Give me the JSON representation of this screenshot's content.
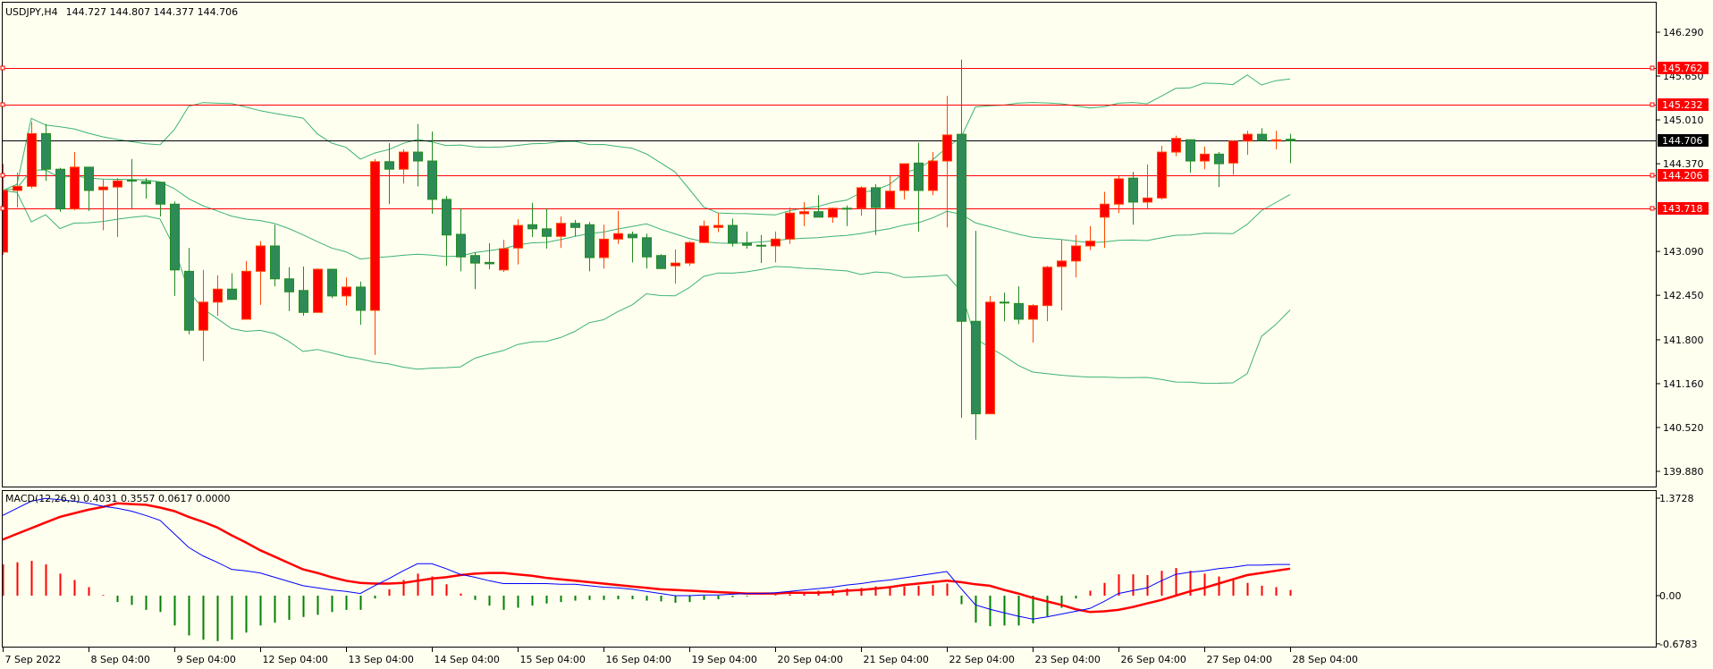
{
  "header": {
    "symbol_timeframe": "USDJPY,H4",
    "ohlc": "144.727 144.807 144.377 144.706"
  },
  "macd_header": "MACD(12,26,9) 0.4031 0.3557 0.0617 0.0000",
  "colors": {
    "background": "#fffff0",
    "bull_fill": "#ff0000",
    "bull_border": "#ff4500",
    "bear_fill": "#2e8b57",
    "bear_border": "#228b22",
    "bands": "#3cb371",
    "level_line": "#ff0000",
    "bid_line": "#000000",
    "macd_line": "#0000ff",
    "signal_line": "#ff0000",
    "hist_up": "#ff0000",
    "hist_down": "#008000"
  },
  "chart_data": [
    {
      "type": "candlestick",
      "title": "USDJPY,H4",
      "ylim": [
        139.6,
        146.73
      ],
      "y_ticks": [
        "146.290",
        "145.650",
        "145.010",
        "144.370",
        "143.090",
        "142.450",
        "141.800",
        "141.160",
        "140.520",
        "139.880"
      ],
      "x_labels": [
        {
          "bar": 0,
          "label": "7 Sep 2022"
        },
        {
          "bar": 6,
          "label": "8 Sep 04:00"
        },
        {
          "bar": 12,
          "label": "9 Sep 04:00"
        },
        {
          "bar": 18,
          "label": "12 Sep 04:00"
        },
        {
          "bar": 24,
          "label": "13 Sep 04:00"
        },
        {
          "bar": 30,
          "label": "14 Sep 04:00"
        },
        {
          "bar": 36,
          "label": "15 Sep 04:00"
        },
        {
          "bar": 42,
          "label": "16 Sep 04:00"
        },
        {
          "bar": 48,
          "label": "19 Sep 04:00"
        },
        {
          "bar": 54,
          "label": "20 Sep 04:00"
        },
        {
          "bar": 60,
          "label": "21 Sep 04:00"
        },
        {
          "bar": 66,
          "label": "22 Sep 04:00"
        },
        {
          "bar": 72,
          "label": "23 Sep 04:00"
        },
        {
          "bar": 78,
          "label": "26 Sep 04:00"
        },
        {
          "bar": 84,
          "label": "27 Sep 04:00"
        },
        {
          "bar": 90,
          "label": "28 Sep 04:00"
        }
      ],
      "levels": [
        {
          "price": 145.762,
          "label": "145.762",
          "kind": "line"
        },
        {
          "price": 145.232,
          "label": "145.232",
          "kind": "line"
        },
        {
          "price": 144.206,
          "label": "144.206",
          "kind": "line"
        },
        {
          "price": 143.718,
          "label": "143.718",
          "kind": "line"
        },
        {
          "price": 144.706,
          "label": "144.706",
          "kind": "bid"
        }
      ],
      "bollinger": {
        "period": 20,
        "deviation": 2
      },
      "ohlc": [
        [
          143.08,
          144.37,
          143.04,
          143.98
        ],
        [
          143.98,
          144.24,
          143.73,
          144.04
        ],
        [
          144.04,
          144.98,
          144.01,
          144.81
        ],
        [
          144.81,
          144.95,
          144.12,
          144.29
        ],
        [
          144.29,
          144.31,
          143.67,
          143.71
        ],
        [
          143.71,
          144.54,
          143.69,
          144.32
        ],
        [
          144.32,
          144.32,
          143.68,
          143.98
        ],
        [
          143.99,
          144.14,
          143.4,
          144.03
        ],
        [
          144.03,
          144.16,
          143.3,
          144.12
        ],
        [
          144.13,
          144.44,
          143.72,
          144.12
        ],
        [
          144.11,
          144.16,
          143.86,
          144.08
        ],
        [
          144.1,
          144.11,
          143.6,
          143.78
        ],
        [
          143.78,
          143.82,
          142.44,
          142.82
        ],
        [
          142.8,
          143.14,
          141.88,
          141.94
        ],
        [
          141.94,
          142.82,
          141.49,
          142.35
        ],
        [
          142.35,
          142.74,
          142.15,
          142.54
        ],
        [
          142.54,
          142.77,
          142.39,
          142.39
        ],
        [
          142.1,
          142.95,
          142.1,
          142.8
        ],
        [
          142.8,
          143.24,
          142.31,
          143.17
        ],
        [
          143.17,
          143.48,
          142.58,
          142.69
        ],
        [
          142.69,
          142.86,
          142.22,
          142.5
        ],
        [
          142.52,
          142.87,
          142.15,
          142.2
        ],
        [
          142.2,
          142.84,
          142.2,
          142.83
        ],
        [
          142.83,
          142.83,
          142.41,
          142.44
        ],
        [
          142.44,
          142.71,
          142.3,
          142.57
        ],
        [
          142.57,
          142.65,
          142.02,
          142.23
        ],
        [
          142.23,
          144.44,
          141.58,
          144.4
        ],
        [
          144.4,
          144.67,
          143.78,
          144.29
        ],
        [
          144.29,
          144.58,
          144.08,
          144.54
        ],
        [
          144.54,
          144.95,
          144.04,
          144.41
        ],
        [
          144.41,
          144.84,
          143.64,
          143.85
        ],
        [
          143.85,
          143.9,
          142.88,
          143.33
        ],
        [
          143.34,
          143.72,
          142.8,
          143.01
        ],
        [
          143.03,
          143.08,
          142.54,
          142.92
        ],
        [
          142.93,
          143.21,
          142.83,
          142.91
        ],
        [
          142.82,
          143.26,
          142.79,
          143.13
        ],
        [
          143.14,
          143.56,
          142.9,
          143.47
        ],
        [
          143.48,
          143.8,
          143.3,
          143.42
        ],
        [
          143.42,
          143.72,
          143.13,
          143.31
        ],
        [
          143.31,
          143.6,
          143.14,
          143.5
        ],
        [
          143.5,
          143.55,
          143.31,
          143.44
        ],
        [
          143.48,
          143.52,
          142.8,
          143.0
        ],
        [
          143.0,
          143.48,
          142.84,
          143.27
        ],
        [
          143.27,
          143.68,
          143.2,
          143.35
        ],
        [
          143.34,
          143.38,
          142.93,
          143.29
        ],
        [
          143.29,
          143.35,
          142.84,
          143.01
        ],
        [
          143.03,
          143.05,
          142.84,
          142.84
        ],
        [
          142.88,
          143.12,
          142.62,
          142.92
        ],
        [
          142.92,
          143.24,
          142.88,
          143.22
        ],
        [
          143.22,
          143.54,
          143.21,
          143.46
        ],
        [
          143.44,
          143.65,
          143.37,
          143.47
        ],
        [
          143.47,
          143.57,
          143.16,
          143.21
        ],
        [
          143.21,
          143.38,
          143.13,
          143.18
        ],
        [
          143.18,
          143.33,
          142.92,
          143.17
        ],
        [
          143.17,
          143.38,
          142.93,
          143.27
        ],
        [
          143.27,
          143.73,
          143.2,
          143.65
        ],
        [
          143.64,
          143.81,
          143.46,
          143.67
        ],
        [
          143.67,
          143.91,
          143.59,
          143.59
        ],
        [
          143.59,
          143.73,
          143.51,
          143.72
        ],
        [
          143.72,
          143.76,
          143.46,
          143.71
        ],
        [
          143.72,
          144.04,
          143.61,
          144.02
        ],
        [
          144.02,
          144.07,
          143.33,
          143.73
        ],
        [
          143.72,
          144.19,
          143.72,
          143.97
        ],
        [
          143.98,
          144.37,
          143.85,
          144.37
        ],
        [
          144.38,
          144.68,
          143.38,
          143.98
        ],
        [
          143.98,
          144.54,
          143.91,
          144.41
        ],
        [
          144.41,
          145.36,
          143.44,
          144.79
        ],
        [
          144.8,
          145.89,
          140.66,
          142.07
        ],
        [
          142.07,
          143.39,
          140.34,
          140.72
        ],
        [
          140.72,
          142.44,
          140.72,
          142.35
        ],
        [
          142.35,
          142.49,
          142.07,
          142.34
        ],
        [
          142.33,
          142.58,
          142.03,
          142.1
        ],
        [
          142.1,
          142.32,
          141.76,
          142.3
        ],
        [
          142.3,
          142.88,
          142.07,
          142.86
        ],
        [
          142.87,
          143.26,
          142.23,
          142.95
        ],
        [
          142.95,
          143.33,
          142.71,
          143.17
        ],
        [
          143.17,
          143.46,
          143.11,
          143.24
        ],
        [
          143.59,
          143.96,
          143.14,
          143.78
        ],
        [
          143.78,
          144.19,
          143.65,
          144.15
        ],
        [
          144.16,
          144.25,
          143.48,
          143.81
        ],
        [
          143.81,
          144.36,
          143.72,
          143.87
        ],
        [
          143.87,
          144.63,
          143.85,
          144.54
        ],
        [
          144.54,
          144.78,
          144.48,
          144.74
        ],
        [
          144.72,
          144.72,
          144.24,
          144.41
        ],
        [
          144.41,
          144.62,
          144.29,
          144.51
        ],
        [
          144.51,
          144.54,
          144.03,
          144.37
        ],
        [
          144.38,
          144.71,
          144.21,
          144.7
        ],
        [
          144.7,
          144.85,
          144.5,
          144.8
        ],
        [
          144.8,
          144.89,
          144.71,
          144.71
        ],
        [
          144.7,
          144.85,
          144.58,
          144.72
        ],
        [
          144.727,
          144.807,
          144.377,
          144.706
        ]
      ]
    },
    {
      "type": "macd",
      "title": "MACD(12,26,9)",
      "ylim": [
        -0.73,
        1.5
      ],
      "y_ticks": [
        "1.3728",
        "0.00",
        "-0.6783"
      ],
      "y_tick_values": [
        1.3728,
        0,
        -0.6783
      ],
      "macd": [
        1.13,
        1.23,
        1.33,
        1.37,
        1.35,
        1.33,
        1.3,
        1.26,
        1.23,
        1.19,
        1.13,
        1.06,
        0.87,
        0.68,
        0.56,
        0.47,
        0.37,
        0.35,
        0.32,
        0.26,
        0.2,
        0.14,
        0.11,
        0.08,
        0.06,
        0.03,
        0.14,
        0.24,
        0.35,
        0.45,
        0.45,
        0.38,
        0.3,
        0.26,
        0.21,
        0.17,
        0.17,
        0.17,
        0.17,
        0.16,
        0.16,
        0.14,
        0.12,
        0.11,
        0.09,
        0.06,
        0.03,
        0.0,
        0.0,
        0.01,
        0.01,
        0.02,
        0.03,
        0.03,
        0.04,
        0.06,
        0.08,
        0.1,
        0.12,
        0.15,
        0.17,
        0.2,
        0.22,
        0.25,
        0.28,
        0.31,
        0.34,
        0.1,
        -0.13,
        -0.19,
        -0.24,
        -0.29,
        -0.33,
        -0.3,
        -0.26,
        -0.22,
        -0.18,
        -0.08,
        0.03,
        0.07,
        0.11,
        0.21,
        0.3,
        0.33,
        0.35,
        0.38,
        0.4,
        0.43,
        0.43,
        0.44,
        0.44
      ],
      "signal": [
        0.79,
        0.87,
        0.95,
        1.03,
        1.11,
        1.16,
        1.21,
        1.25,
        1.3,
        1.29,
        1.28,
        1.24,
        1.19,
        1.11,
        1.04,
        0.96,
        0.85,
        0.75,
        0.64,
        0.55,
        0.46,
        0.37,
        0.32,
        0.26,
        0.21,
        0.18,
        0.17,
        0.17,
        0.18,
        0.21,
        0.24,
        0.26,
        0.29,
        0.31,
        0.32,
        0.32,
        0.3,
        0.28,
        0.25,
        0.23,
        0.21,
        0.19,
        0.17,
        0.15,
        0.13,
        0.11,
        0.09,
        0.08,
        0.07,
        0.06,
        0.05,
        0.04,
        0.03,
        0.03,
        0.03,
        0.04,
        0.04,
        0.04,
        0.05,
        0.07,
        0.08,
        0.1,
        0.12,
        0.15,
        0.17,
        0.19,
        0.21,
        0.19,
        0.16,
        0.14,
        0.08,
        0.03,
        -0.03,
        -0.08,
        -0.13,
        -0.19,
        -0.23,
        -0.22,
        -0.2,
        -0.16,
        -0.11,
        -0.06,
        0.0,
        0.06,
        0.11,
        0.17,
        0.23,
        0.29,
        0.32,
        0.35,
        0.38
      ],
      "histogram": [
        0.44,
        0.47,
        0.49,
        0.44,
        0.31,
        0.22,
        0.12,
        0.01,
        -0.09,
        -0.13,
        -0.2,
        -0.23,
        -0.42,
        -0.56,
        -0.62,
        -0.64,
        -0.62,
        -0.52,
        -0.42,
        -0.38,
        -0.34,
        -0.3,
        -0.27,
        -0.23,
        -0.2,
        -0.2,
        -0.04,
        0.09,
        0.22,
        0.31,
        0.27,
        0.16,
        0.03,
        -0.06,
        -0.14,
        -0.2,
        -0.17,
        -0.14,
        -0.11,
        -0.09,
        -0.07,
        -0.06,
        -0.06,
        -0.05,
        -0.05,
        -0.07,
        -0.08,
        -0.1,
        -0.09,
        -0.06,
        -0.05,
        -0.02,
        -0.01,
        0.0,
        0.01,
        0.02,
        0.04,
        0.07,
        0.09,
        0.1,
        0.11,
        0.13,
        0.13,
        0.13,
        0.14,
        0.15,
        0.17,
        -0.12,
        -0.38,
        -0.43,
        -0.42,
        -0.42,
        -0.39,
        -0.29,
        -0.17,
        -0.04,
        0.07,
        0.18,
        0.3,
        0.3,
        0.29,
        0.35,
        0.39,
        0.35,
        0.31,
        0.27,
        0.22,
        0.18,
        0.14,
        0.12,
        0.08
      ]
    }
  ]
}
